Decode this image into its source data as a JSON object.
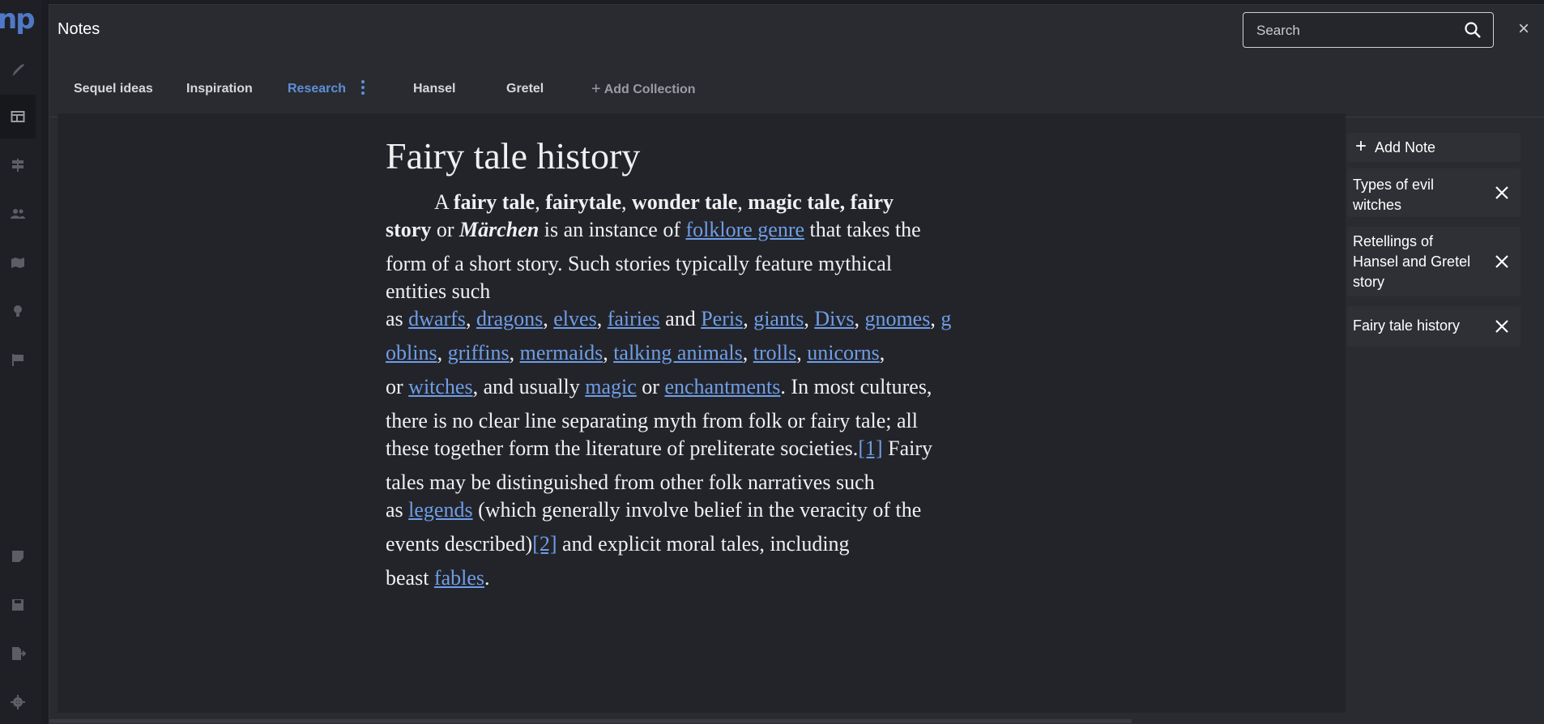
{
  "app": {
    "logo_text": "np"
  },
  "rail": {
    "icons": [
      "feather-icon",
      "layout-icon",
      "signpost-icon",
      "users-icon",
      "map-icon",
      "lightbulb-icon",
      "flag-icon",
      "notes-icon",
      "save-icon",
      "export-icon",
      "gear-icon"
    ]
  },
  "modal": {
    "title": "Notes",
    "search_placeholder": "Search",
    "close_glyph": "×"
  },
  "tabs": [
    {
      "label": "Sequel ideas"
    },
    {
      "label": "Inspiration"
    },
    {
      "label": "Research",
      "active": true
    },
    {
      "label": "Hansel"
    },
    {
      "label": "Gretel"
    }
  ],
  "add_collection_label": "Add Collection",
  "document": {
    "title": "Fairy tale history",
    "lines": [
      {
        "segments": [
          {
            "t": "A "
          },
          {
            "t": "fairy tale",
            "b": true
          },
          {
            "t": ", "
          },
          {
            "t": "fairytale",
            "b": true
          },
          {
            "t": ", "
          },
          {
            "t": "wonder tale",
            "b": true
          },
          {
            "t": ", "
          },
          {
            "t": "magic tale, fairy",
            "b": true
          }
        ]
      },
      {
        "segments": [
          {
            "t": "story",
            "b": true
          },
          {
            "t": " or "
          },
          {
            "t": "Märchen",
            "b": true,
            "i": true
          },
          {
            "t": " is an instance of "
          },
          {
            "t": "folklore genre",
            "link": true
          },
          {
            "t": " that takes the"
          }
        ]
      },
      {
        "segments": [
          {
            "t": "form of a short story. Such stories typically feature mythical"
          }
        ]
      },
      {
        "segments": [
          {
            "t": "entities such"
          }
        ]
      },
      {
        "segments": [
          {
            "t": "as "
          },
          {
            "t": "dwarfs",
            "link": true
          },
          {
            "t": ", "
          },
          {
            "t": "dragons",
            "link": true
          },
          {
            "t": ", "
          },
          {
            "t": "elves",
            "link": true
          },
          {
            "t": ", "
          },
          {
            "t": "fairies",
            "link": true
          },
          {
            "t": " and "
          },
          {
            "t": "Peris",
            "link": true
          },
          {
            "t": ", "
          },
          {
            "t": "giants",
            "link": true
          },
          {
            "t": ", "
          },
          {
            "t": "Divs",
            "link": true
          },
          {
            "t": ", "
          },
          {
            "t": "gnomes",
            "link": true
          },
          {
            "t": ", "
          },
          {
            "t": "g",
            "link": true
          }
        ]
      },
      {
        "segments": [
          {
            "t": "oblins",
            "link": true
          },
          {
            "t": ", "
          },
          {
            "t": "griffins",
            "link": true
          },
          {
            "t": ", "
          },
          {
            "t": "mermaids",
            "link": true
          },
          {
            "t": ", "
          },
          {
            "t": "talking animals",
            "link": true
          },
          {
            "t": ", "
          },
          {
            "t": "trolls",
            "link": true
          },
          {
            "t": ", "
          },
          {
            "t": "unicorns",
            "link": true
          },
          {
            "t": ","
          }
        ]
      },
      {
        "segments": [
          {
            "t": "or "
          },
          {
            "t": "witches",
            "link": true
          },
          {
            "t": ", and usually "
          },
          {
            "t": "magic",
            "link": true
          },
          {
            "t": " or "
          },
          {
            "t": "enchantments",
            "link": true
          },
          {
            "t": ". In most cultures,"
          }
        ]
      },
      {
        "segments": [
          {
            "t": "there is no clear line separating myth from folk or fairy tale; all"
          }
        ]
      },
      {
        "segments": [
          {
            "t": "these together form the literature of preliterate societies."
          },
          {
            "t": "[1]",
            "link": true,
            "ref": true
          },
          {
            "t": " Fairy"
          }
        ]
      },
      {
        "segments": [
          {
            "t": "tales may be distinguished from other folk narratives such"
          }
        ]
      },
      {
        "segments": [
          {
            "t": "as "
          },
          {
            "t": "legends",
            "link": true
          },
          {
            "t": " (which generally involve belief in the veracity of the"
          }
        ]
      },
      {
        "segments": [
          {
            "t": "events described)"
          },
          {
            "t": "[2]",
            "link": true,
            "ref": true
          },
          {
            "t": " and explicit moral tales, including"
          }
        ]
      },
      {
        "segments": [
          {
            "t": "beast "
          },
          {
            "t": "fables",
            "link": true
          },
          {
            "t": "."
          }
        ]
      }
    ]
  },
  "notes_panel": {
    "add_note_label": "Add Note",
    "notes": [
      {
        "title": "Types of evil witches"
      },
      {
        "title": "Retellings of Hansel and Gretel story"
      },
      {
        "title": "Fairy tale history"
      }
    ]
  }
}
